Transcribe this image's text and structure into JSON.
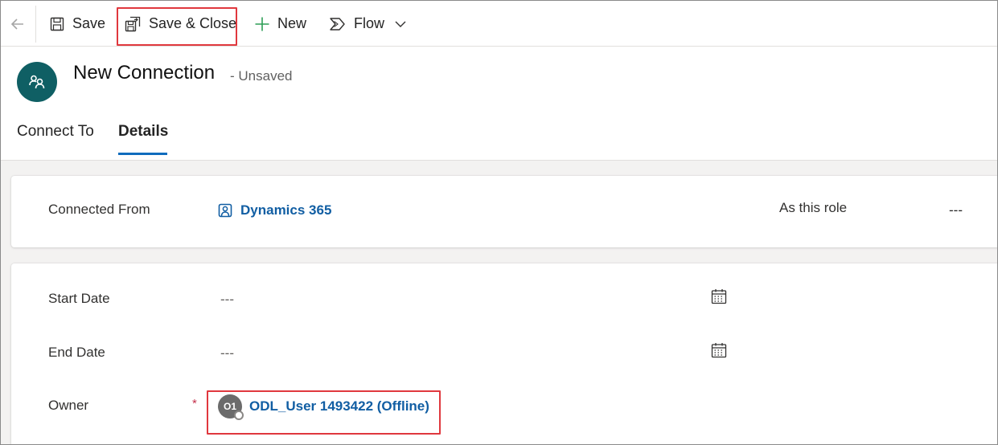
{
  "toolbar": {
    "save_label": "Save",
    "save_close_label": "Save & Close",
    "new_label": "New",
    "flow_label": "Flow"
  },
  "header": {
    "avatar_icon": "connection-icon",
    "title": "New Connection",
    "status": "- Unsaved"
  },
  "tabs": [
    {
      "label": "Connect To",
      "selected": false
    },
    {
      "label": "Details",
      "selected": true
    }
  ],
  "connected_from": {
    "label": "Connected From",
    "value": "Dynamics 365",
    "role_label": "As this role",
    "role_value": "---"
  },
  "dates": {
    "start_label": "Start Date",
    "start_value": "---",
    "end_label": "End Date",
    "end_value": "---"
  },
  "owner": {
    "label": "Owner",
    "required_marker": "*",
    "initials": "O1",
    "value": "ODL_User 1493422 (Offline)"
  },
  "colors": {
    "accent": "#0f6cbd",
    "link": "#115ea3",
    "highlight": "#e0383e",
    "avatar": "#0f5f64"
  }
}
